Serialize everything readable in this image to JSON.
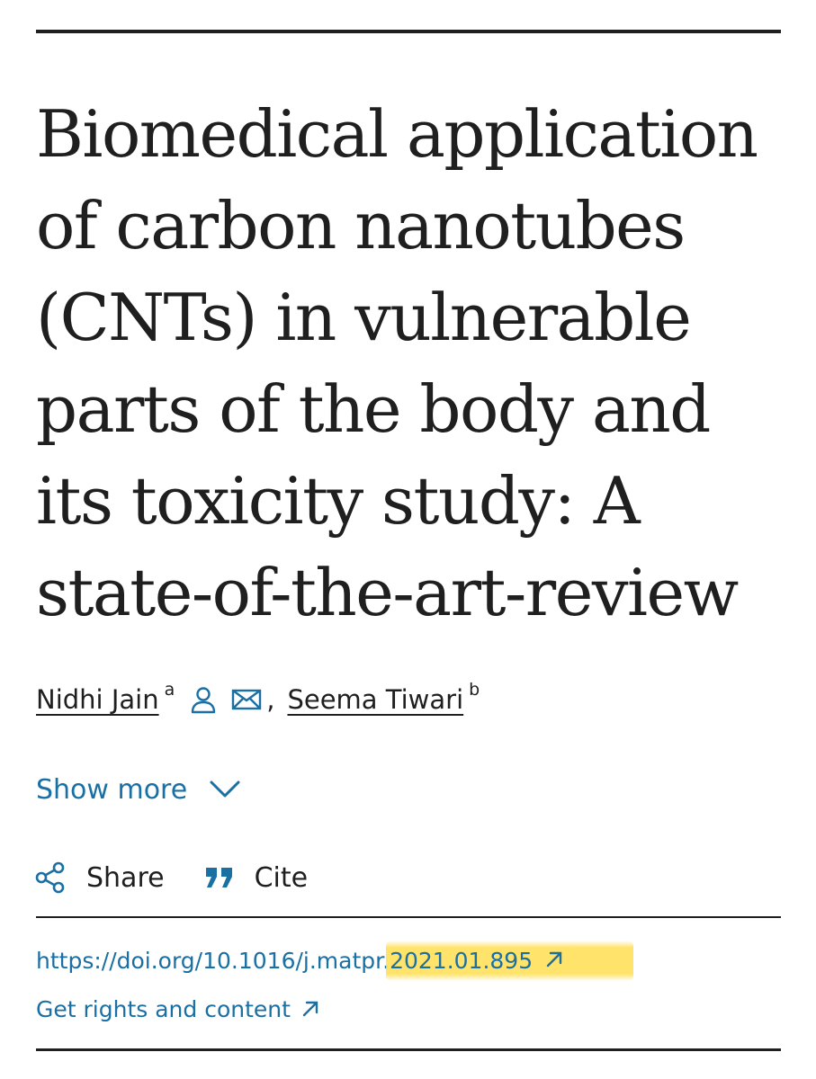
{
  "article": {
    "title": "Biomedical application of carbon nanotubes (CNTs) in vulnerable parts of the body and its toxicity study: A state-of-the-art-review",
    "authors": [
      {
        "name": "Nidhi Jain",
        "affiliation": "a"
      },
      {
        "name": "Seema Tiwari",
        "affiliation": "b"
      }
    ],
    "author_separator": ",",
    "show_more_label": "Show more",
    "share_label": "Share",
    "cite_label": "Cite",
    "doi_prefix": "https://doi.org/10.1016/j.matpr.",
    "doi_highlighted": "2021.01.895",
    "rights_label": "Get rights and content"
  },
  "icons": {
    "author_profile": "person-icon",
    "author_email": "envelope-icon",
    "show_more": "chevron-down-icon",
    "share": "share-icon",
    "cite": "quote-icon",
    "external_link": "arrow-up-right-icon"
  },
  "colors": {
    "link": "#1a6fa3",
    "text": "#1f1f1f",
    "highlight": "#ffde50"
  }
}
